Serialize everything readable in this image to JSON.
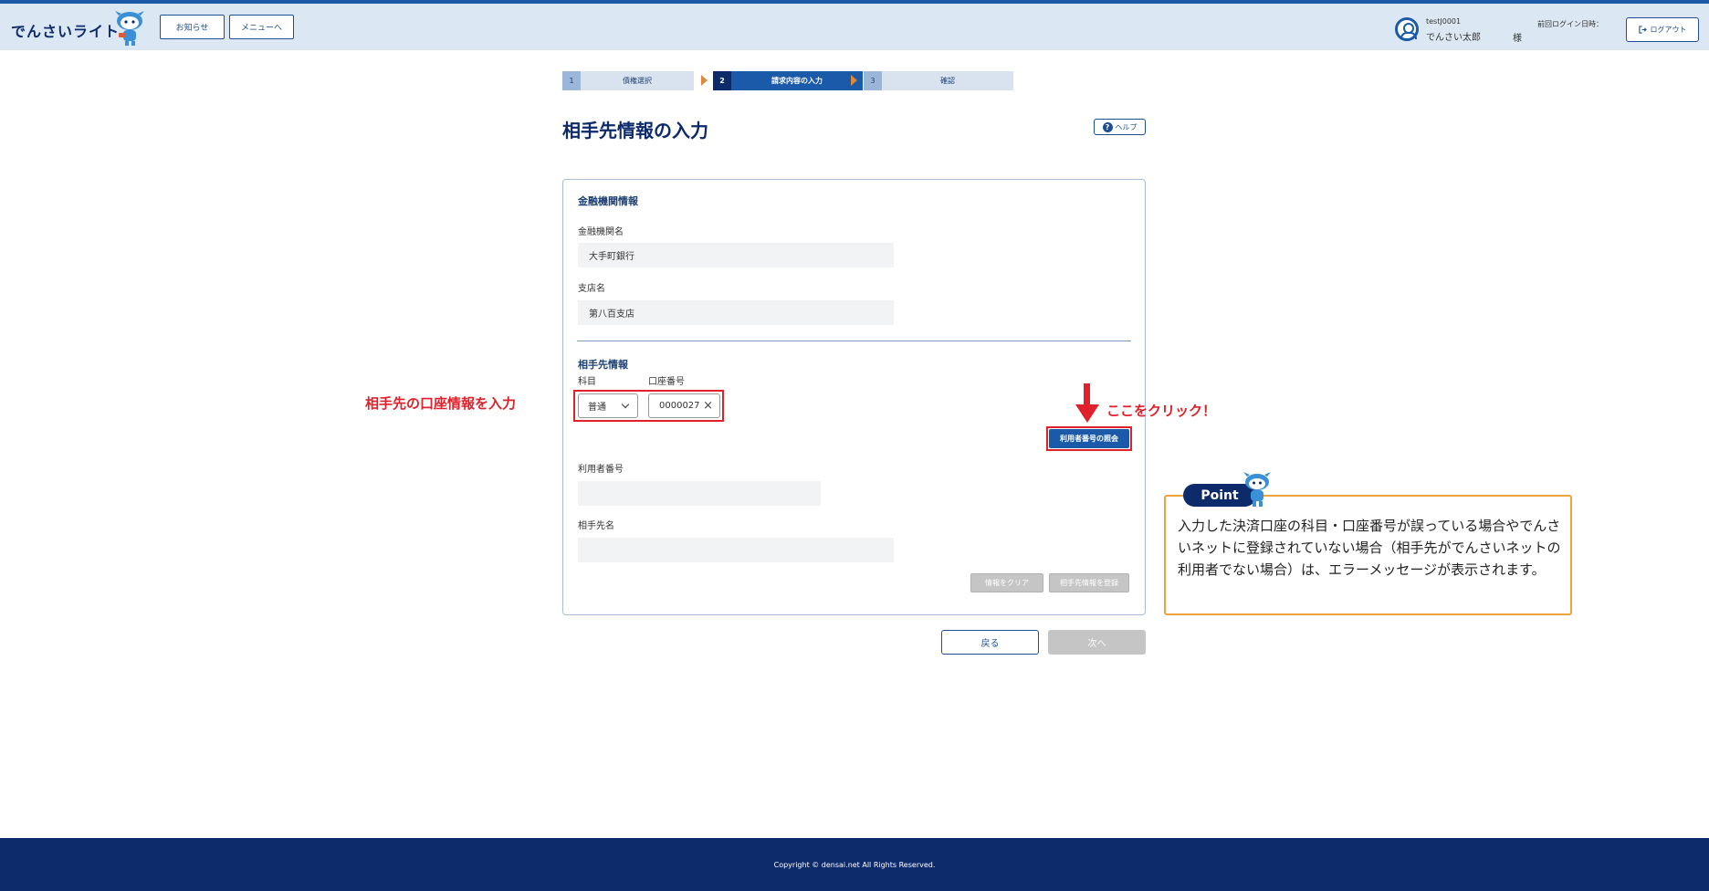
{
  "header": {
    "logo_text": "でんさいライト",
    "news_button": "お知らせ",
    "menu_button": "メニューへ",
    "user_id": "testJ0001",
    "user_name": "でんさい太郎",
    "honorific": "様",
    "last_login_label": "前回ログイン日時：",
    "logout_button": "ログアウト"
  },
  "steps": [
    {
      "num": "1",
      "label": "債権選択"
    },
    {
      "num": "2",
      "label": "請求内容の入力"
    },
    {
      "num": "3",
      "label": "確認"
    }
  ],
  "page": {
    "title": "相手先情報の入力",
    "help_button": "ヘルプ"
  },
  "bank_section": {
    "title": "金融機関情報",
    "bank_name_label": "金融機関名",
    "bank_name_value": "大手町銀行",
    "branch_label": "支店名",
    "branch_value": "第八百支店"
  },
  "partner_section": {
    "title": "相手先情報",
    "subject_label": "科目",
    "account_no_label": "口座番号",
    "subject_value": "普通",
    "account_no_value": "0000027",
    "inquiry_button": "利用者番号の照会",
    "user_no_label": "利用者番号",
    "user_no_value": "",
    "partner_name_label": "相手先名",
    "partner_name_value": "",
    "clear_button": "情報をクリア",
    "register_button": "相手先情報を登録"
  },
  "nav": {
    "back_button": "戻る",
    "next_button": "次へ"
  },
  "annotations": {
    "left_note": "相手先の口座情報を入力",
    "click_note": "ここをクリック！",
    "point_badge": "Point",
    "point_text": "入力した決済口座の科目・口座番号が誤っている場合やでんさいネットに登録されていない場合（相手先がでんさいネットの利用者でない場合）は、エラーメッセージが表示されます。"
  },
  "footer": {
    "copyright": "Copyright © densai.net All Rights Reserved."
  },
  "colors": {
    "brand_navy": "#0d2a6b",
    "brand_blue": "#1a5aa8",
    "header_bg": "#dbe8f4",
    "annotation_red": "#e0202a",
    "point_orange": "#f0a23b"
  }
}
